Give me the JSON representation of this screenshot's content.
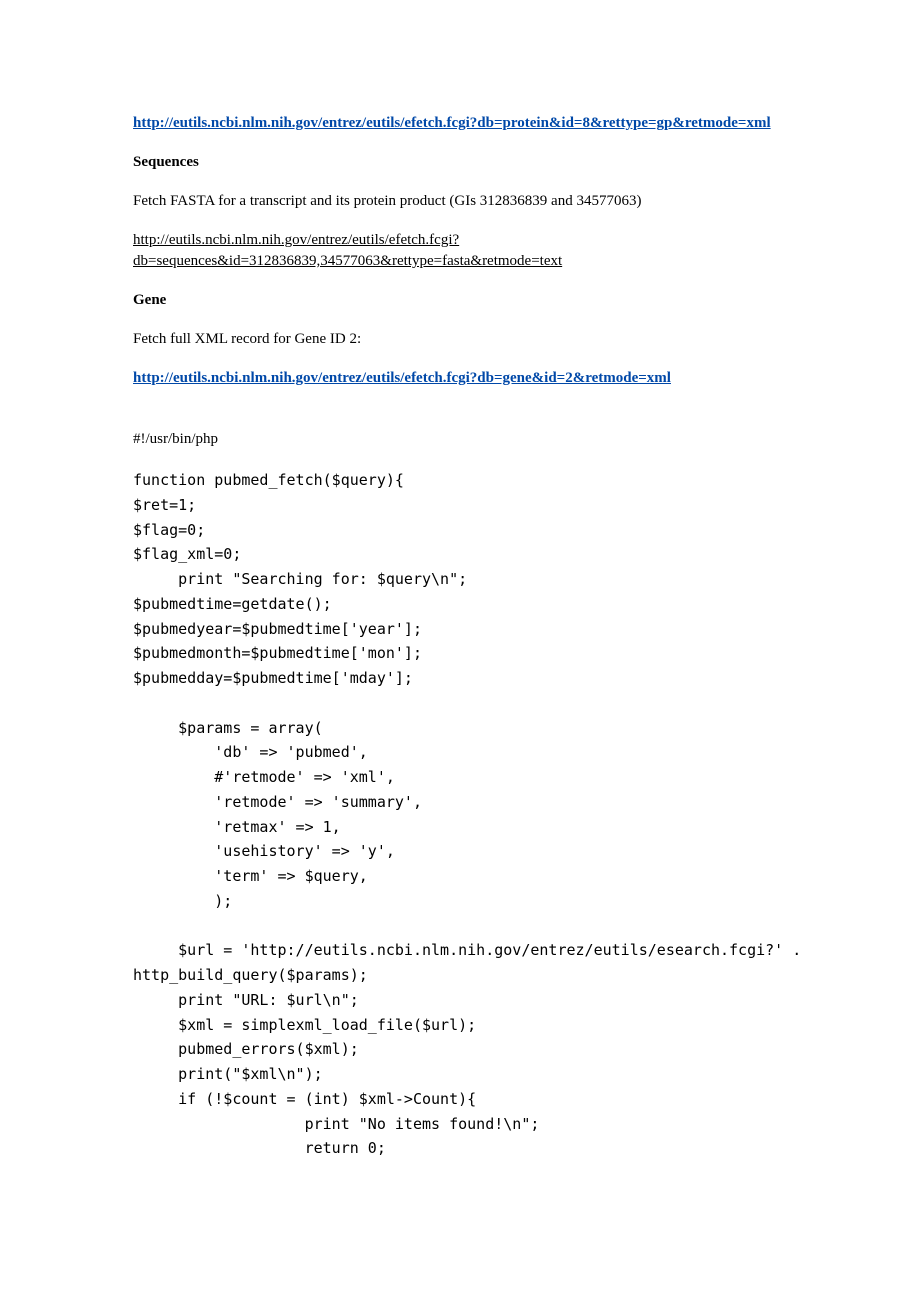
{
  "link_protein": "http://eutils.ncbi.nlm.nih.gov/entrez/eutils/efetch.fcgi?db=protein&id=8&rettype=gp&retmode=xml",
  "heading_sequences": "Sequences",
  "text_sequences": "Fetch FASTA for a transcript and its protein product (GIs 312836839 and 34577063)",
  "link_sequences": "http://eutils.ncbi.nlm.nih.gov/entrez/eutils/efetch.fcgi?db=sequences&id=312836839,34577063&rettype=fasta&retmode=text",
  "heading_gene": "Gene",
  "text_gene": "Fetch full XML record for Gene ID 2:",
  "link_gene": "http://eutils.ncbi.nlm.nih.gov/entrez/eutils/efetch.fcgi?db=gene&id=2&retmode=xml",
  "shebang": "#!/usr/bin/php",
  "code": "function pubmed_fetch($query){\n$ret=1;\n$flag=0;\n$flag_xml=0;\n     print \"Searching for: $query\\n\";\n$pubmedtime=getdate();\n$pubmedyear=$pubmedtime['year'];\n$pubmedmonth=$pubmedtime['mon'];\n$pubmedday=$pubmedtime['mday'];\n\n     $params = array(\n         'db' => 'pubmed',\n         #'retmode' => 'xml',\n         'retmode' => 'summary',\n         'retmax' => 1,\n         'usehistory' => 'y',\n         'term' => $query,\n         );\n\n     $url = 'http://eutils.ncbi.nlm.nih.gov/entrez/eutils/esearch.fcgi?' .\nhttp_build_query($params);\n     print \"URL: $url\\n\";\n     $xml = simplexml_load_file($url);\n     pubmed_errors($xml);\n     print(\"$xml\\n\");\n     if (!$count = (int) $xml->Count){\n                   print \"No items found!\\n\";\n                   return 0;"
}
